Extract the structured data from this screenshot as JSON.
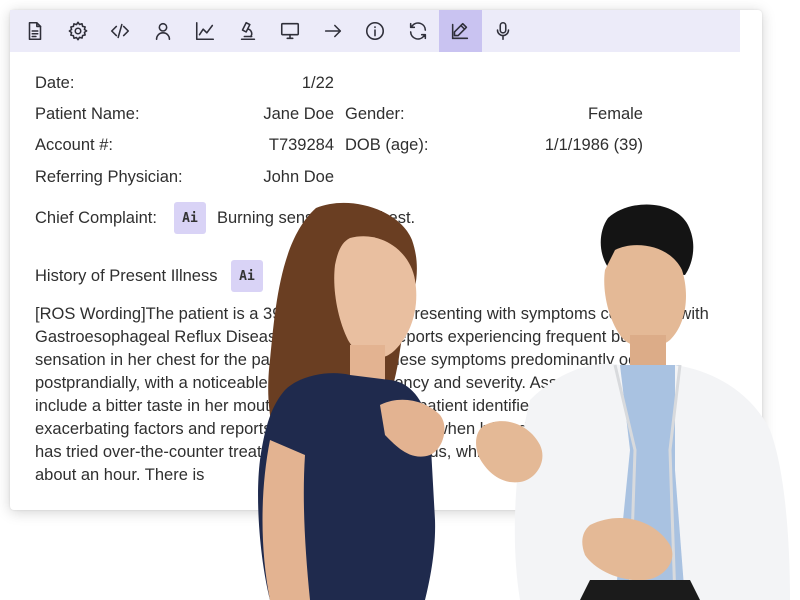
{
  "toolbar": {
    "tools": [
      {
        "icon": "document-icon"
      },
      {
        "icon": "gear-icon"
      },
      {
        "icon": "code-icon"
      },
      {
        "icon": "user-icon"
      },
      {
        "icon": "line-chart-icon"
      },
      {
        "icon": "microscope-icon"
      },
      {
        "icon": "monitor-icon"
      },
      {
        "icon": "arrow-right-icon"
      },
      {
        "icon": "info-icon"
      },
      {
        "icon": "refresh-icon"
      },
      {
        "icon": "edit-icon",
        "active": true
      },
      {
        "icon": "microphone-icon"
      }
    ],
    "active_color": "#c9c3f1",
    "bar_color": "#ecebf9"
  },
  "patient": {
    "date_label": "Date:",
    "date_value": "1/22",
    "name_label": "Patient Name:",
    "name_value": "Jane Doe",
    "gender_label": "Gender:",
    "gender_value": "Female",
    "account_label": "Account #:",
    "account_value": "T739284",
    "dob_label": "DOB (age):",
    "dob_value": "1/1/1986 (39)",
    "physician_label": "Referring Physician:",
    "physician_value": "John Doe"
  },
  "complaint": {
    "label": "Chief Complaint:",
    "ai_label": "Ai",
    "value": "Burning sensation in chest."
  },
  "hpi": {
    "label": "History of Present Illness",
    "ai_label": "Ai",
    "text": "[ROS Wording]The patient is a 39-year-old female presenting with symptoms consistent with Gastroesophageal Reflux Disease (GERD). She reports experiencing frequent burning sensation in her chest for the past two months. These symptoms predominantly occur postprandially, with a noticeable increase in frequency and severity. Associated symptoms include a bitter taste in her mouth upon waking. The patient identifies spicy foods and coffee as exacerbating factors and reports worsening symptoms when lying down soon after eating. She has tried over-the-counter treatments, including antacids, which provide temporary relief for about an hour. There is"
  },
  "photo": {
    "description_icon": "doctor-patient-photo"
  }
}
